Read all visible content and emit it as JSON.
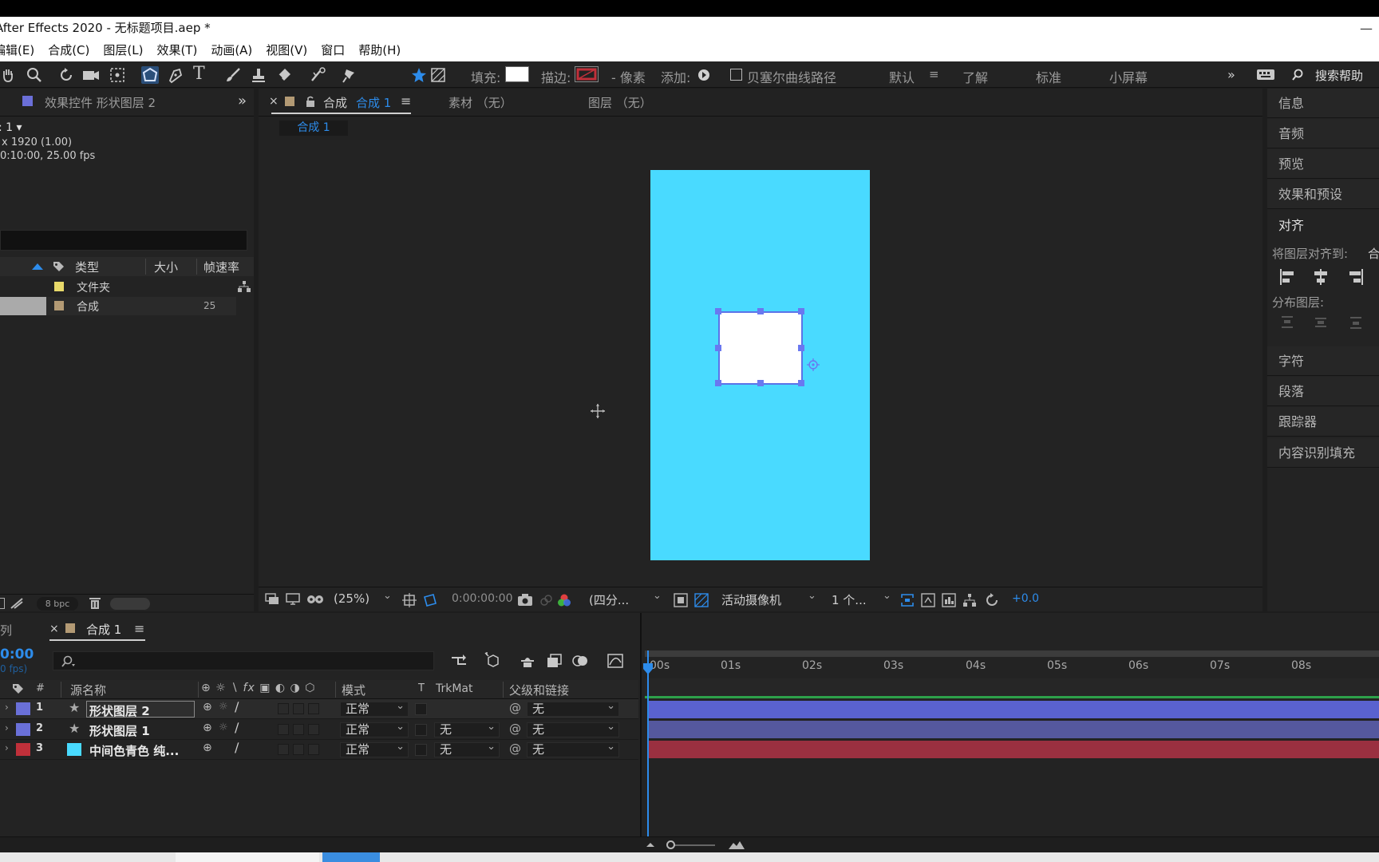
{
  "window": {
    "title": "After Effects 2020 - 无标题项目.aep *"
  },
  "menu": [
    "编辑(E)",
    "合成(C)",
    "图层(L)",
    "效果(T)",
    "动画(A)",
    "视图(V)",
    "窗口",
    "帮助(H)"
  ],
  "toolbar": {
    "fill_label": "填充:",
    "stroke_label": "描边:",
    "stroke_px": "- 像素",
    "add_label": "添加:",
    "bezier_label": "贝塞尔曲线路径",
    "workspaces": [
      "默认",
      "了解",
      "标准",
      "小屏幕"
    ],
    "search_help": "搜索帮助",
    "colors": {
      "fill": "#ffffff",
      "stroke": "#c0303a",
      "accent": "#2d8ceb"
    }
  },
  "project_panel": {
    "tab_label": "效果控件 形状图层 2",
    "comp_name": "1 ▾",
    "comp_dims": "x 1920 (1.00)",
    "comp_duration": "0:10:00, 25.00 fps",
    "columns": [
      "类型",
      "大小",
      "帧速率"
    ],
    "rows": [
      {
        "type": "文件夹",
        "size": "",
        "fps": "",
        "color": "#e8d96a"
      },
      {
        "type": "合成",
        "size": "",
        "fps": "25",
        "color": "#b39a74"
      }
    ],
    "bpc": "8 bpc"
  },
  "comp_panel": {
    "tabs": [
      {
        "label": "合成",
        "name": "合成 1"
      },
      {
        "label": "素材 （无）"
      },
      {
        "label": "图层 （无）"
      }
    ],
    "subtab": "合成 1",
    "zoom": "(25%)",
    "timecode": "0:00:00:00",
    "resolution": "(四分...",
    "camera": "活动摄像机",
    "views": "1 个...",
    "exposure": "+0.0",
    "colors": {
      "background": "#49daff",
      "shape": "#ffffff",
      "handles": "#6a78f0"
    }
  },
  "right_panel": {
    "items": [
      "信息",
      "音频",
      "预览",
      "效果和预设",
      "对齐"
    ],
    "align_to_label": "将图层对齐到:",
    "align_to_value": "合",
    "distribute_label": "分布图层:",
    "items2": [
      "字符",
      "段落",
      "跟踪器",
      "内容识别填充"
    ]
  },
  "timeline": {
    "left_tab": "列",
    "tab_label": "合成 1",
    "timecode": "0:00",
    "fps_hint": "0 fps)",
    "columns": {
      "num": "#",
      "source": "源名称",
      "mode": "模式",
      "t": "T",
      "trkmat": "TrkMat",
      "parent": "父级和链接"
    },
    "layers": [
      {
        "index": "1",
        "name": "形状图层 2",
        "mode": "正常",
        "trkmat": "",
        "parent": "无",
        "color": "#6a70d8",
        "bar": "#5a62cf"
      },
      {
        "index": "2",
        "name": "形状图层 1",
        "mode": "正常",
        "trkmat": "无",
        "parent": "无",
        "color": "#6a70d8",
        "bar": "#55589e"
      },
      {
        "index": "3",
        "name": "中间色青色 纯...",
        "mode": "正常",
        "trkmat": "无",
        "parent": "无",
        "color": "#c0303a",
        "bar": "#9a3040"
      }
    ],
    "ruler_ticks": [
      "00s",
      "01s",
      "02s",
      "03s",
      "04s",
      "05s",
      "06s",
      "07s",
      "08s"
    ]
  }
}
